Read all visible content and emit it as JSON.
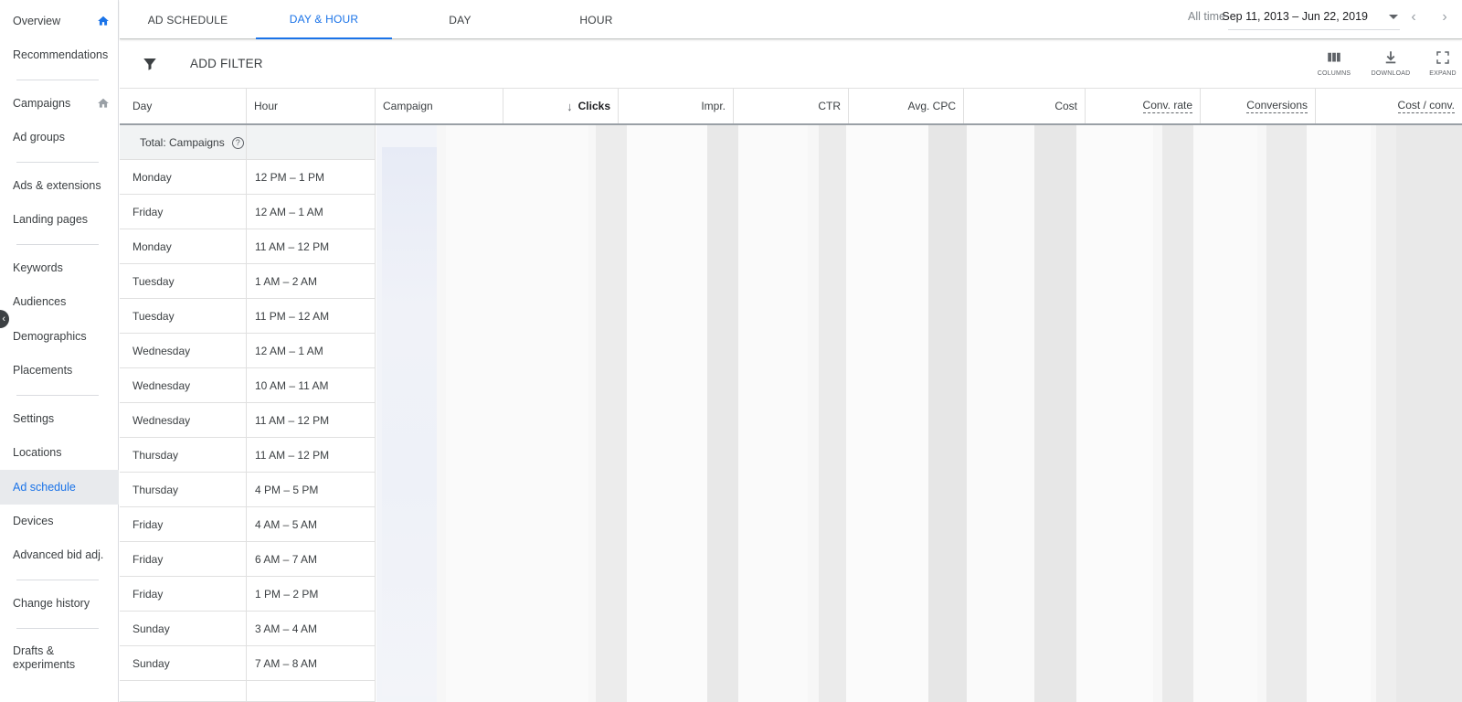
{
  "sidebar": {
    "items": [
      {
        "label": "Overview",
        "icon": "home-icon"
      },
      {
        "label": "Recommendations"
      },
      {
        "label": "Campaigns",
        "icon": "home-icon"
      },
      {
        "label": "Ad groups"
      },
      {
        "label": "Ads & extensions"
      },
      {
        "label": "Landing pages"
      },
      {
        "label": "Keywords"
      },
      {
        "label": "Audiences"
      },
      {
        "label": "Demographics"
      },
      {
        "label": "Placements"
      },
      {
        "label": "Settings"
      },
      {
        "label": "Locations"
      },
      {
        "label": "Ad schedule",
        "active": true
      },
      {
        "label": "Devices"
      },
      {
        "label": "Advanced bid adj."
      },
      {
        "label": "Change history"
      },
      {
        "label": "Drafts & experiments"
      }
    ]
  },
  "tabs": [
    {
      "label": "AD SCHEDULE"
    },
    {
      "label": "DAY & HOUR",
      "active": true
    },
    {
      "label": "DAY"
    },
    {
      "label": "HOUR"
    }
  ],
  "date": {
    "label": "All time",
    "range": "Sep 11, 2013 – Jun 22, 2019"
  },
  "filter": {
    "label": "ADD FILTER"
  },
  "tools": {
    "columns": "COLUMNS",
    "download": "DOWNLOAD",
    "expand": "EXPAND"
  },
  "table": {
    "headers": {
      "day": "Day",
      "hour": "Hour",
      "campaign": "Campaign",
      "clicks": "Clicks",
      "impr": "Impr.",
      "ctr": "CTR",
      "avg_cpc": "Avg. CPC",
      "cost": "Cost",
      "conv_rate": "Conv. rate",
      "conversions": "Conversions",
      "cost_conv": "Cost / conv."
    },
    "total_label": "Total: Campaigns",
    "rows": [
      {
        "day": "Monday",
        "hour": "12 PM – 1 PM"
      },
      {
        "day": "Friday",
        "hour": "12 AM – 1 AM"
      },
      {
        "day": "Monday",
        "hour": "11 AM – 12 PM"
      },
      {
        "day": "Tuesday",
        "hour": "1 AM – 2 AM"
      },
      {
        "day": "Tuesday",
        "hour": "11 PM – 12 AM"
      },
      {
        "day": "Wednesday",
        "hour": "12 AM – 1 AM"
      },
      {
        "day": "Wednesday",
        "hour": "10 AM – 11 AM"
      },
      {
        "day": "Wednesday",
        "hour": "11 AM – 12 PM"
      },
      {
        "day": "Thursday",
        "hour": "11 AM – 12 PM"
      },
      {
        "day": "Thursday",
        "hour": "4 PM – 5 PM"
      },
      {
        "day": "Friday",
        "hour": "4 AM – 5 AM"
      },
      {
        "day": "Friday",
        "hour": "6 AM – 7 AM"
      },
      {
        "day": "Friday",
        "hour": "1 PM – 2 PM"
      },
      {
        "day": "Sunday",
        "hour": "3 AM – 4 AM"
      },
      {
        "day": "Sunday",
        "hour": "7 AM – 8 AM"
      }
    ]
  },
  "colors": {
    "accent": "#1a73e8",
    "active_bg": "#e8eaed"
  }
}
